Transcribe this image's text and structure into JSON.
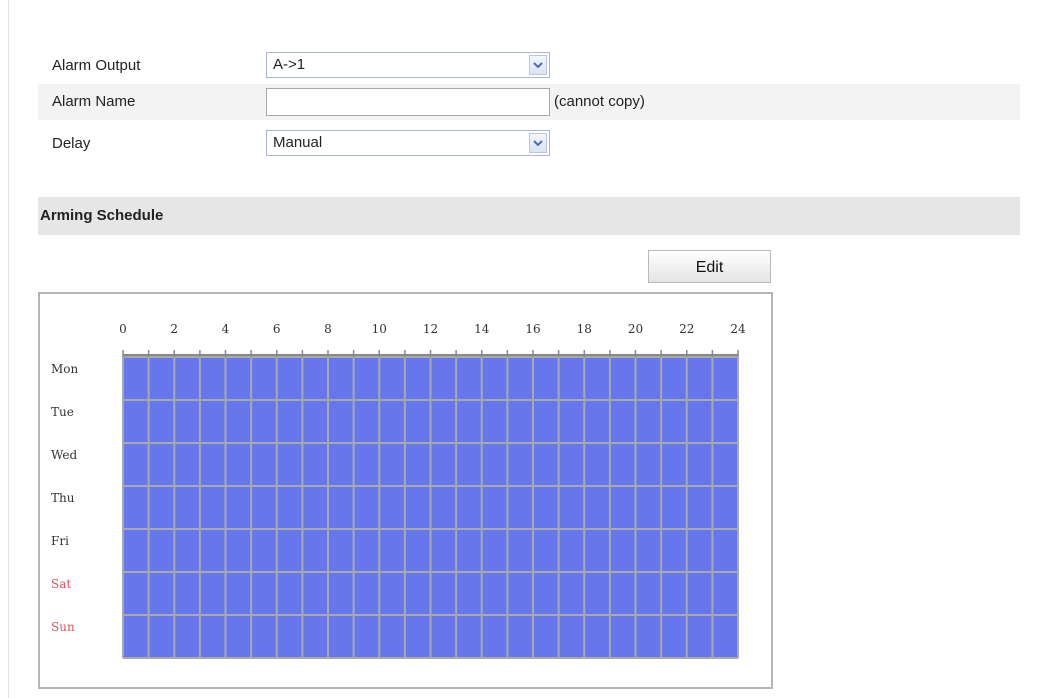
{
  "form": {
    "alarm_output": {
      "label": "Alarm Output",
      "value": "A->1"
    },
    "alarm_name": {
      "label": "Alarm Name",
      "value": "",
      "hint": "(cannot copy)"
    },
    "delay": {
      "label": "Delay",
      "value": "Manual"
    }
  },
  "schedule": {
    "title": "Arming Schedule",
    "edit_label": "Edit",
    "hour_labels": [
      "0",
      "2",
      "4",
      "6",
      "8",
      "10",
      "12",
      "14",
      "16",
      "18",
      "20",
      "22",
      "24"
    ],
    "days": [
      {
        "label": "Mon",
        "weekend": false
      },
      {
        "label": "Tue",
        "weekend": false
      },
      {
        "label": "Wed",
        "weekend": false
      },
      {
        "label": "Thu",
        "weekend": false
      },
      {
        "label": "Fri",
        "weekend": false
      },
      {
        "label": "Sat",
        "weekend": true
      },
      {
        "label": "Sun",
        "weekend": true
      }
    ],
    "armed_ranges": [
      [
        0,
        24
      ],
      [
        0,
        24
      ],
      [
        0,
        24
      ],
      [
        0,
        24
      ],
      [
        0,
        24
      ],
      [
        0,
        24
      ],
      [
        0,
        24
      ]
    ],
    "colors": {
      "armed": "#6677ee",
      "grid": "#a9a9a9",
      "weekday_label": "#333333",
      "weekend_label": "#e0525a"
    }
  },
  "icons": {
    "dropdown": "chevron-down-icon"
  }
}
